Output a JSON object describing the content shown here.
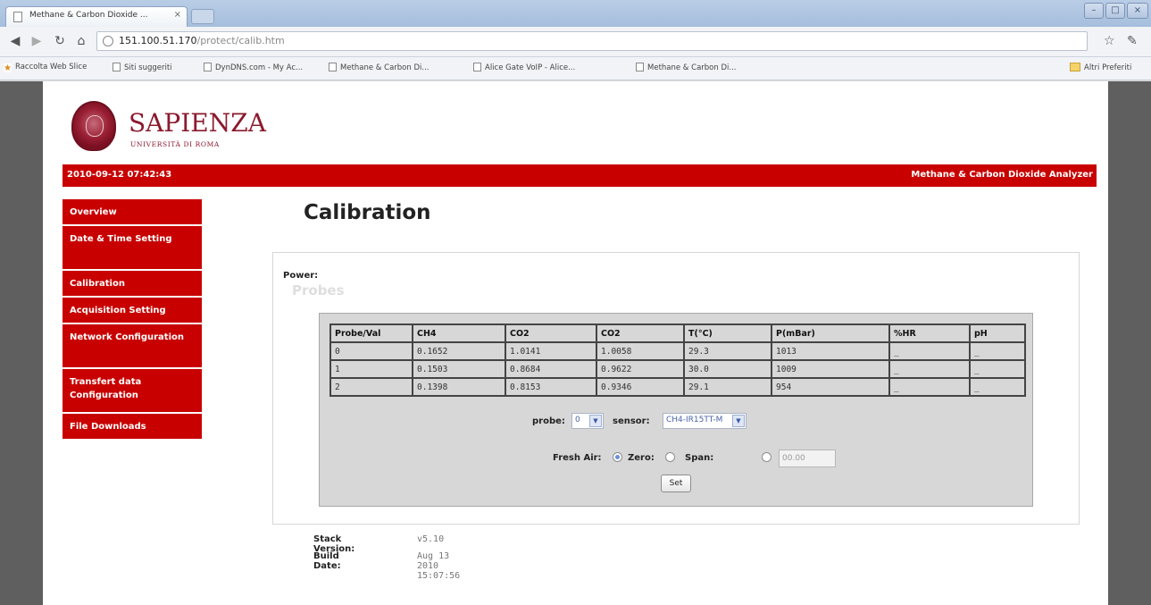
{
  "browser": {
    "tab_title": "Methane & Carbon Dioxide ...",
    "tab_close": "×",
    "url_host": "151.100.51.170",
    "url_path": "/protect/calib.htm",
    "bookmarks": [
      {
        "label": "Raccolta Web Slice",
        "icon": "star"
      },
      {
        "label": "Siti suggeriti",
        "icon": "page"
      },
      {
        "label": "DynDNS.com - My Ac...",
        "icon": "page"
      },
      {
        "label": "Methane & Carbon Di...",
        "icon": "page"
      },
      {
        "label": "Alice Gate VoIP - Alice...",
        "icon": "page"
      },
      {
        "label": "Methane & Carbon Di...",
        "icon": "page"
      }
    ],
    "other_bookmarks": "Altri Preferiti"
  },
  "header": {
    "brand": "SAPIENZA",
    "brand_sub": "UNIVERSITÀ DI ROMA",
    "datetime": "2010-09-12 07:42:43",
    "app_title": "Methane & Carbon Dioxide Analyzer"
  },
  "sidebar": {
    "items": [
      {
        "label": "Overview"
      },
      {
        "label": "Date & Time Setting"
      },
      {
        "label": "Calibration"
      },
      {
        "label": "Acquisition Setting"
      },
      {
        "label": "Network Configuration"
      },
      {
        "label": "Transfert data Configuration"
      },
      {
        "label": "File Downloads"
      }
    ]
  },
  "main": {
    "title": "Calibration",
    "power_label": "Power:",
    "probes_label": "Probes",
    "table": {
      "headers": [
        "Probe/Val",
        "CH4",
        "CO2",
        "CO2",
        "T(°C)",
        "P(mBar)",
        "%HR",
        "pH"
      ],
      "rows": [
        [
          "0",
          "0.1652",
          "1.0141",
          "1.0058",
          "29.3",
          "1013",
          "_",
          "_"
        ],
        [
          "1",
          "0.1503",
          "0.8684",
          "0.9622",
          "30.0",
          "1009",
          "_",
          "_"
        ],
        [
          "2",
          "0.1398",
          "0.8153",
          "0.9346",
          "29.1",
          "954",
          "_",
          "_"
        ]
      ]
    },
    "probe_label": "probe:",
    "probe_value": "0",
    "sensor_label": "sensor:",
    "sensor_value": "CH4-IR15TT-M",
    "fresh_air_label": "Fresh Air:",
    "zero_label": "Zero:",
    "span_label": "Span:",
    "span_value": "00.00",
    "selected_mode": "fresh_air",
    "set_button": "Set"
  },
  "footer": {
    "stack_version_label": "Stack Version:",
    "stack_version": "v5.10",
    "build_date_label": "Build Date:",
    "build_date": "Aug 13 2010 15:07:56"
  },
  "colors": {
    "accent_red": "#c80000",
    "brand_maroon": "#8b1a2e"
  }
}
